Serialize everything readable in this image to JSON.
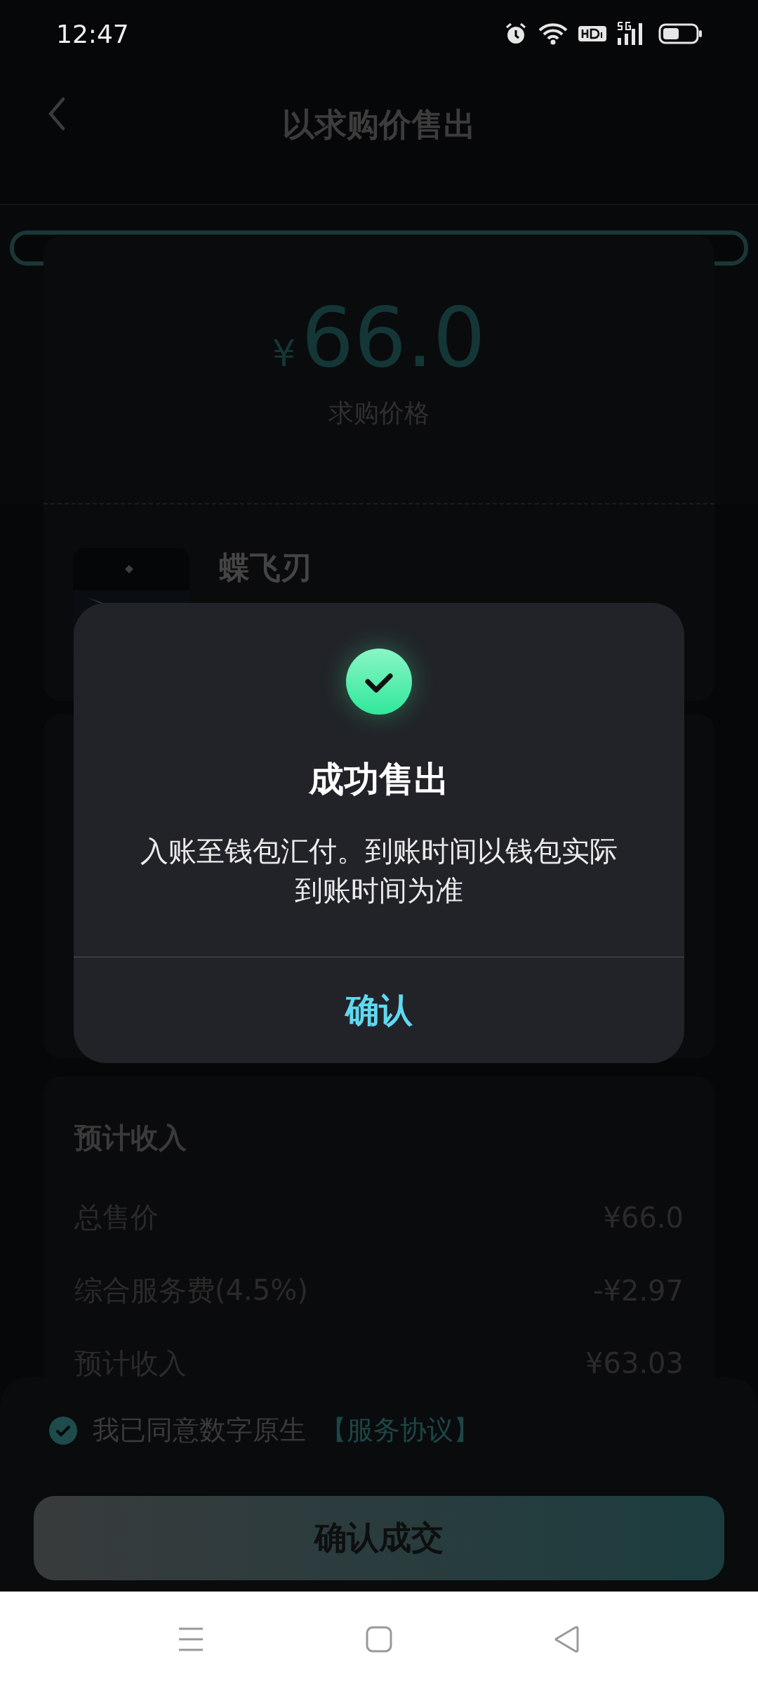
{
  "status_bar": {
    "time": "12:47"
  },
  "header": {
    "title": "以求购价售出"
  },
  "price_card": {
    "currency": "¥",
    "amount": "66.0",
    "label": "求购价格"
  },
  "product": {
    "name": "蝶飞刃"
  },
  "income": {
    "title": "预计收入",
    "rows": [
      {
        "label": "总售价",
        "value": "¥66.0"
      },
      {
        "label": "综合服务费(4.5%)",
        "value": "-¥2.97"
      },
      {
        "label": "预计收入",
        "value": "¥63.03"
      }
    ]
  },
  "agreement": {
    "checked": true,
    "text": "我已同意数字原生",
    "link": "【服务协议】"
  },
  "confirm_button": "确认成交",
  "dialog": {
    "title": "成功售出",
    "message": "入账至钱包汇付。到账时间以钱包实际到账时间为准",
    "button": "确认"
  }
}
